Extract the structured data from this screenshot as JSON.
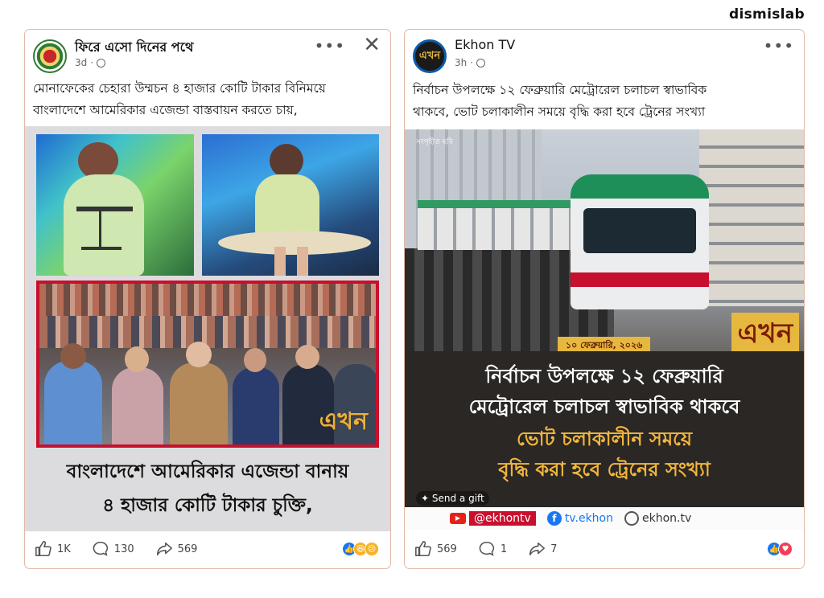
{
  "brand": "dismislab",
  "post1": {
    "page_name": "ফিরে এসো দিনের পথে",
    "time": "3d",
    "text_line1": "মোনাফেকের চেহারা উম্মচন ৪ হাজার কোটি টাকার বিনিময়ে",
    "text_line2": "বাংলাদেশে আমেরিকার এজেন্ডা বাস্তবায়ন করতে চায়,",
    "image": {
      "logo": "এখন",
      "headline_line1": "বাংলাদেশে আমেরিকার এজেন্ডা বানায়",
      "headline_line2": "৪ হাজার কোটি টাকার চুক্তি,"
    },
    "likes": "1K",
    "comments": "130",
    "shares": "569",
    "icons": [
      "globe-icon",
      "more-options-icon",
      "close-icon",
      "like-icon",
      "comment-icon",
      "share-icon"
    ],
    "reactions": [
      "like",
      "haha",
      "sad"
    ]
  },
  "post2": {
    "page_name": "Ekhon TV",
    "time": "3h",
    "text_line1": "নির্বাচন উপলক্ষে ১২ ফেব্রুয়ারি মেট্রোরেল চলাচল স্বাভাবিক",
    "text_line2": "থাকবে, ভোট চলাকালীন সময়ে বৃদ্ধি করা হবে ট্রেনের সংখ্যা",
    "image": {
      "stock_label": "সংগৃহীত ছবি",
      "date": "১০ ফেব্রুয়ারি, ২০২৬",
      "logo": "এখন",
      "headline_line1": "নির্বাচন উপলক্ষে ১২ ফেব্রুয়ারি",
      "headline_line2": "মেট্রোরেল চলাচল স্বাভাবিক থাকবে",
      "headline_line3": "ভোট চলাকালীন সময়ে",
      "headline_line4": "বৃদ্ধি করা হবে ট্রেনের সংখ্যা",
      "send_gift": "Send a gift",
      "social_youtube": "@ekhontv",
      "social_facebook": "tv.ekhon",
      "social_web": "ekhon.tv"
    },
    "likes": "569",
    "comments": "1",
    "shares": "7",
    "reactions": [
      "like",
      "love"
    ]
  },
  "colors": {
    "card_border": "#e2b9a7",
    "accent_yellow": "#e7b83f",
    "metro_green": "#1f8f5a",
    "dark_panel": "#2a2725"
  }
}
